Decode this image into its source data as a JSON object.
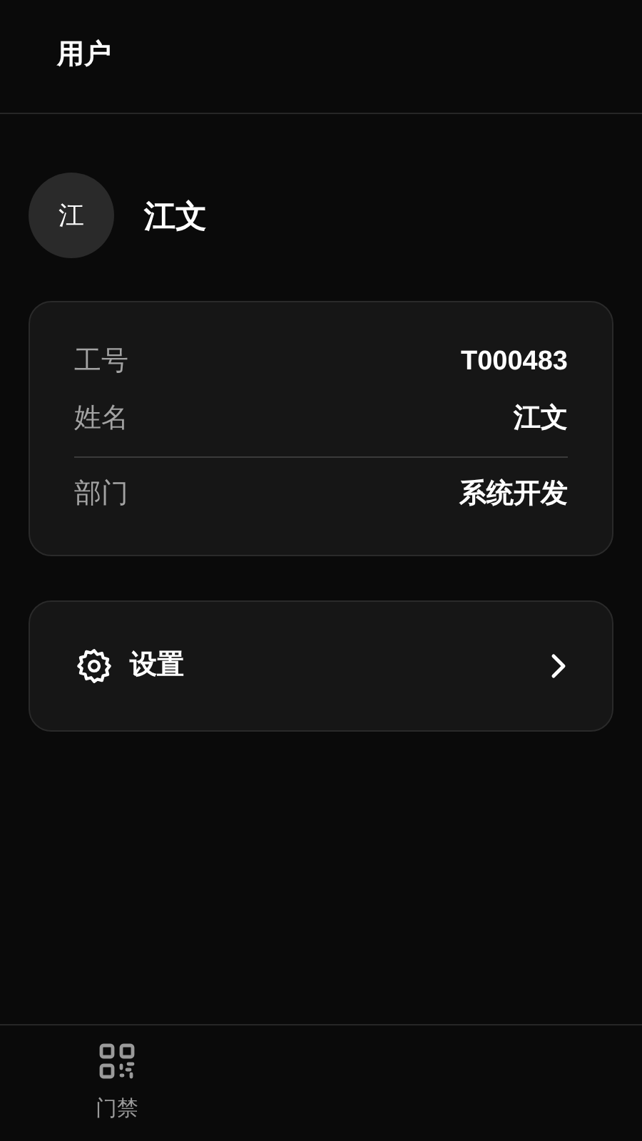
{
  "header": {
    "title": "用户"
  },
  "profile": {
    "avatar": "江",
    "name": "江文"
  },
  "info": {
    "groups": [
      [
        {
          "label": "工号",
          "value": "T000483"
        },
        {
          "label": "姓名",
          "value": "江文"
        }
      ],
      [
        {
          "label": "部门",
          "value": "系统开发"
        }
      ]
    ]
  },
  "menu": [
    {
      "label": "设置"
    }
  ],
  "tab_bar": [
    {
      "label": "门禁",
      "selected": false
    }
  ]
}
